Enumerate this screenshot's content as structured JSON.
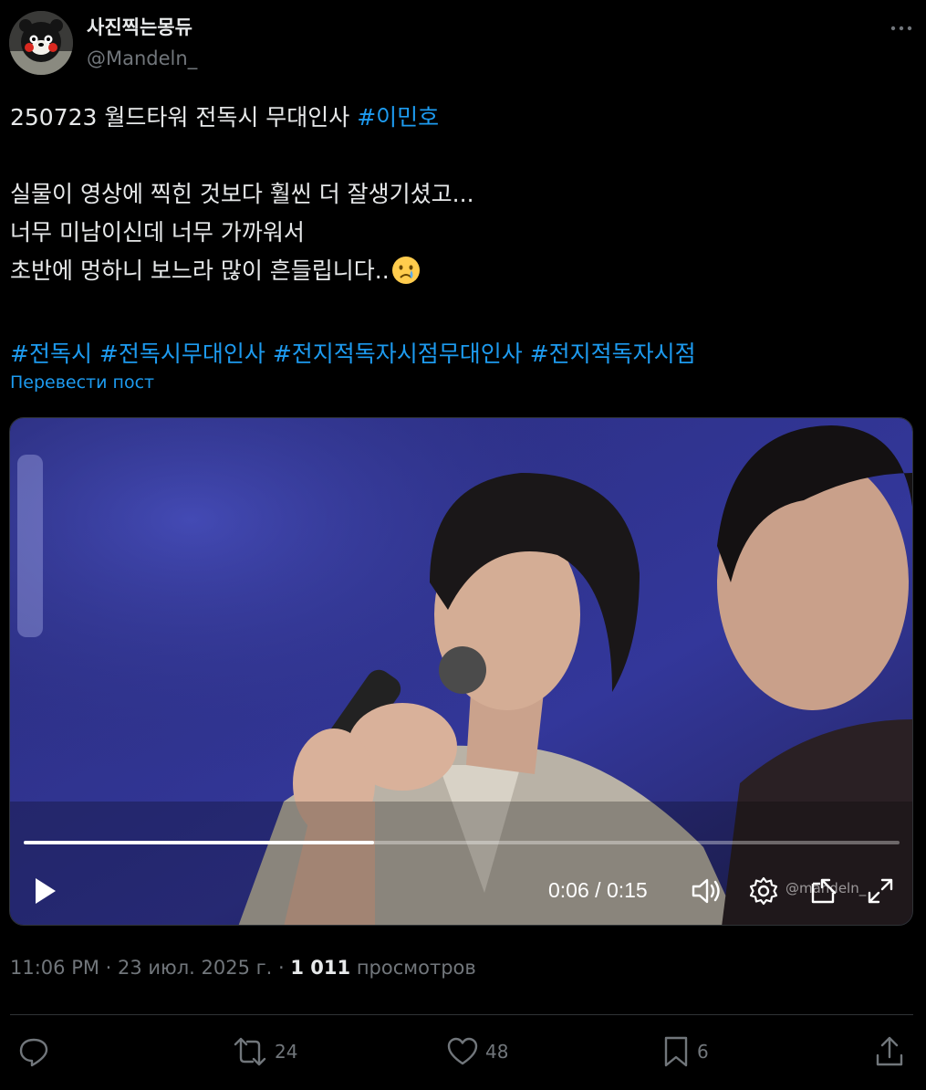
{
  "author": {
    "display_name": "사진찍는몽듀",
    "handle": "@Mandeln_",
    "avatar_icon": "mascot-bear-avatar-icon"
  },
  "tweet": {
    "line1_text": "250723 월드타워 전독시 무대인사 ",
    "line1_hashtag": "#이민호",
    "line2": "실물이 영상에 찍힌 것보다 훨씬 더 잘생기셨고...",
    "line3": "너무 미남이신데 너무 가까워서",
    "line4": "초반에 멍하니 보느라 많이 흔들립니다..",
    "line4_emoji": "crying-face-emoji",
    "hashtags": [
      "#전독시",
      "#전독시무대인사",
      "#전지적독자시점무대인사",
      "#전지적독자시점"
    ],
    "translate_label": "Перевести пост"
  },
  "video": {
    "current_time": "0:06",
    "separator": " / ",
    "duration": "0:15",
    "progress": 0.4,
    "watermark": "@mandeln_"
  },
  "meta": {
    "time": "11:06 PM",
    "dot1": " · ",
    "date": "23 июл. 2025 г.",
    "dot2": " · ",
    "views_count": "1 011",
    "views_label": " просмотров"
  },
  "actions": {
    "reply_count": "",
    "retweet_count": "24",
    "like_count": "48",
    "bookmark_count": "6"
  },
  "colors": {
    "background": "#000000",
    "text": "#e7e9ea",
    "secondary": "#71767b",
    "link": "#1d9bf0"
  }
}
